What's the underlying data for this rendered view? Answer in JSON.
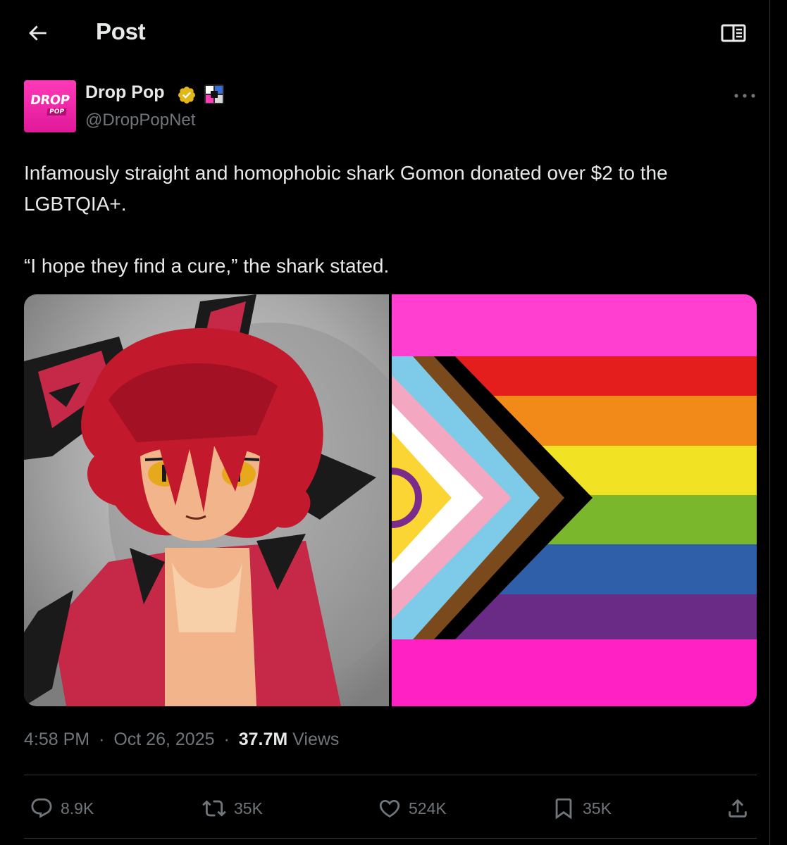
{
  "header": {
    "title": "Post",
    "back_icon": "arrow-left-icon",
    "reader_icon": "reader-mode-icon"
  },
  "author": {
    "display_name": "Drop Pop",
    "handle": "@DropPopNet",
    "avatar_logo_top": "DROP",
    "avatar_logo_bottom": "POP",
    "verified_icon": "verified-gold-badge-icon",
    "affiliate_icon": "affiliate-badge-icon",
    "more_icon": "more-options-icon"
  },
  "tweet": {
    "line1": "Infamously straight and homophobic shark Gomon donated over $2 to the LGBTQIA+.",
    "line2": "“I hope they find a cure,” the shark stated."
  },
  "media": {
    "left_image": "illustration of red-haired shark character Gomon",
    "right_image": "progress pride flag"
  },
  "meta": {
    "time": "4:58 PM",
    "date": "Oct 26, 2025",
    "views_count": "37.7M",
    "views_label": "Views",
    "separator": "·"
  },
  "actions": {
    "reply_count": "8.9K",
    "repost_count": "35K",
    "like_count": "524K",
    "bookmark_count": "35K"
  },
  "colors": {
    "background": "#000000",
    "text_primary": "#e7e9ea",
    "text_secondary": "#71767b",
    "divider": "#2f3336",
    "verified_gold": "#e2b719",
    "brand_pink": "#ff3ab8"
  }
}
